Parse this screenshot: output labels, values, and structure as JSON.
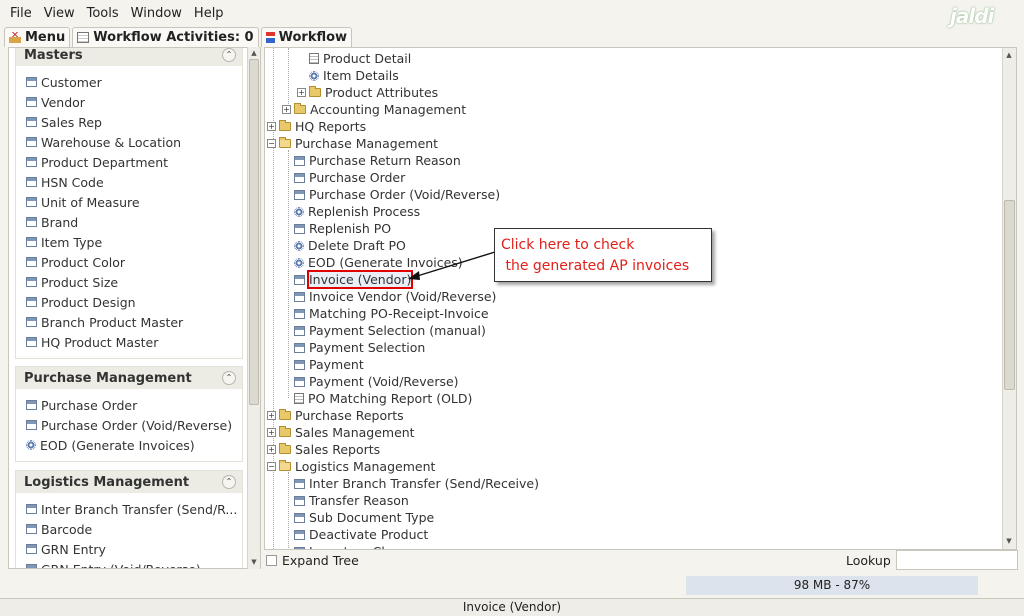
{
  "menubar": {
    "items": [
      "File",
      "View",
      "Tools",
      "Window",
      "Help"
    ],
    "logo": "jaldi"
  },
  "tabs": [
    {
      "label": "Menu"
    },
    {
      "label": "Workflow Activities: 0"
    },
    {
      "label": "Workflow"
    }
  ],
  "left_panel": {
    "groups": [
      {
        "title": "Masters",
        "items": [
          {
            "label": "Customer",
            "icon": "window-icon"
          },
          {
            "label": "Vendor",
            "icon": "window-icon"
          },
          {
            "label": "Sales Rep",
            "icon": "window-icon"
          },
          {
            "label": "Warehouse & Location",
            "icon": "window-icon"
          },
          {
            "label": "Product Department",
            "icon": "window-icon"
          },
          {
            "label": "HSN Code",
            "icon": "window-icon"
          },
          {
            "label": "Unit of Measure",
            "icon": "window-icon"
          },
          {
            "label": "Brand",
            "icon": "window-icon"
          },
          {
            "label": "Item Type",
            "icon": "window-icon"
          },
          {
            "label": "Product Color",
            "icon": "window-icon"
          },
          {
            "label": "Product Size",
            "icon": "window-icon"
          },
          {
            "label": "Product Design",
            "icon": "window-icon"
          },
          {
            "label": "Branch Product Master",
            "icon": "window-icon"
          },
          {
            "label": "HQ Product Master",
            "icon": "window-icon"
          }
        ]
      },
      {
        "title": "Purchase Management",
        "items": [
          {
            "label": "Purchase Order",
            "icon": "window-icon"
          },
          {
            "label": "Purchase Order (Void/Reverse)",
            "icon": "window-icon"
          },
          {
            "label": "EOD (Generate Invoices)",
            "icon": "gear-icon"
          }
        ]
      },
      {
        "title": "Logistics Management",
        "items": [
          {
            "label": "Inter Branch Transfer (Send/R...",
            "icon": "window-icon"
          },
          {
            "label": "Barcode",
            "icon": "window-icon"
          },
          {
            "label": "GRN Entry",
            "icon": "window-icon"
          },
          {
            "label": "GRN Entry (Void/Reverse)",
            "icon": "window-icon"
          }
        ]
      }
    ]
  },
  "tree": {
    "nodes": [
      {
        "label": "Product Detail",
        "icon": "doc-icon",
        "level": 2
      },
      {
        "label": "Item Details",
        "icon": "gear-icon",
        "level": 2
      },
      {
        "label": "Product Attributes",
        "icon": "folder-icon",
        "level": 2,
        "expander": "+"
      },
      {
        "label": "Accounting Management",
        "icon": "folder-icon",
        "level": 1,
        "expander": "+"
      },
      {
        "label": "HQ Reports",
        "icon": "folder-icon",
        "level": 0,
        "expander": "+"
      },
      {
        "label": "Purchase Management",
        "icon": "folder-open-icon",
        "level": 0,
        "expander": "-"
      },
      {
        "label": "Purchase Return Reason",
        "icon": "window-icon",
        "level": 1
      },
      {
        "label": "Purchase Order",
        "icon": "window-icon",
        "level": 1
      },
      {
        "label": "Purchase Order (Void/Reverse)",
        "icon": "window-icon",
        "level": 1
      },
      {
        "label": "Replenish Process",
        "icon": "gear-icon",
        "level": 1
      },
      {
        "label": "Replenish PO",
        "icon": "window-icon",
        "level": 1
      },
      {
        "label": "Delete Draft PO",
        "icon": "gear-icon",
        "level": 1
      },
      {
        "label": "EOD (Generate Invoices)",
        "icon": "gear-icon",
        "level": 1
      },
      {
        "label": "Invoice (Vendor)",
        "icon": "window-icon",
        "level": 1,
        "selected": true
      },
      {
        "label": "Invoice Vendor (Void/Reverse)",
        "icon": "window-icon",
        "level": 1
      },
      {
        "label": "Matching PO-Receipt-Invoice",
        "icon": "window-icon",
        "level": 1
      },
      {
        "label": "Payment Selection (manual)",
        "icon": "window-icon",
        "level": 1
      },
      {
        "label": "Payment Selection",
        "icon": "window-icon",
        "level": 1
      },
      {
        "label": "Payment",
        "icon": "window-icon",
        "level": 1
      },
      {
        "label": "Payment (Void/Reverse)",
        "icon": "window-icon",
        "level": 1
      },
      {
        "label": "PO Matching Report (OLD)",
        "icon": "doc-icon",
        "level": 1
      },
      {
        "label": "Purchase Reports",
        "icon": "folder-icon",
        "level": 0,
        "expander": "+"
      },
      {
        "label": "Sales Management",
        "icon": "folder-icon",
        "level": 0,
        "expander": "+"
      },
      {
        "label": "Sales Reports",
        "icon": "folder-icon",
        "level": 0,
        "expander": "+"
      },
      {
        "label": "Logistics Management",
        "icon": "folder-open-icon",
        "level": 0,
        "expander": "-"
      },
      {
        "label": "Inter Branch Transfer (Send/Receive)",
        "icon": "window-icon",
        "level": 1
      },
      {
        "label": "Transfer Reason",
        "icon": "window-icon",
        "level": 1
      },
      {
        "label": "Sub Document Type",
        "icon": "window-icon",
        "level": 1
      },
      {
        "label": "Deactivate Product",
        "icon": "window-icon",
        "level": 1
      },
      {
        "label": "Inventory Change",
        "icon": "window-icon",
        "level": 1
      }
    ]
  },
  "annotation": {
    "line1": "Click here to check",
    "line2": " the generated AP invoices",
    "color": "#e0201a"
  },
  "bottom": {
    "expand_tree": "Expand Tree",
    "lookup": "Lookup",
    "lookup_value": "",
    "memory": "98 MB - 87%"
  },
  "status": "Invoice (Vendor)"
}
